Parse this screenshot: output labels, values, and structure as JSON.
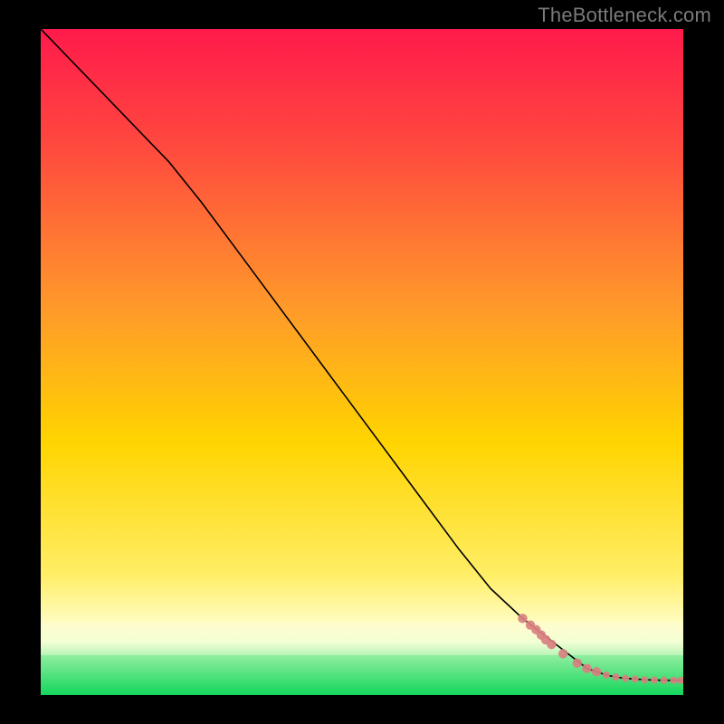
{
  "attribution": "TheBottleneck.com",
  "chart_data": {
    "type": "line",
    "title": "",
    "xlabel": "",
    "ylabel": "",
    "xlim": [
      0,
      100
    ],
    "ylim": [
      0,
      100
    ],
    "background_gradient_top": "#ff1a4b",
    "background_gradient_mid": "#ffd400",
    "background_gradient_green": "#14d65c",
    "accent_green_band_top": 6,
    "accent_white_band_top": 11,
    "accent_white_band_bottom": 9,
    "line_color": "#000000",
    "marker_color": "#d98080",
    "series": [
      {
        "name": "curve",
        "x": [
          0,
          5,
          10,
          15,
          20,
          25,
          30,
          35,
          40,
          45,
          50,
          55,
          60,
          65,
          70,
          75,
          77,
          79,
          81,
          83,
          85,
          86.5,
          88,
          89.5,
          91,
          92.5,
          94,
          95.5,
          97,
          98.5,
          100
        ],
        "y": [
          100,
          95,
          90,
          85,
          80,
          74,
          67.5,
          61,
          54.5,
          48,
          41.5,
          35,
          28.5,
          22,
          16,
          11.5,
          10,
          8.5,
          7,
          5.5,
          4,
          3.5,
          3,
          2.7,
          2.5,
          2.4,
          2.3,
          2.25,
          2.22,
          2.21,
          2.2
        ]
      }
    ],
    "scatter_points": {
      "name": "markers",
      "x": [
        75,
        76.2,
        77.1,
        77.9,
        78.6,
        79.5,
        81.3,
        83.5,
        85,
        86.5,
        88,
        89.5,
        91,
        92.5,
        94,
        95.5,
        97,
        98.5,
        99.6
      ],
      "y": [
        11.5,
        10.5,
        9.8,
        9.0,
        8.3,
        7.6,
        6.2,
        4.8,
        4.0,
        3.5,
        3.0,
        2.7,
        2.5,
        2.4,
        2.3,
        2.25,
        2.22,
        2.21,
        2.2
      ]
    }
  }
}
